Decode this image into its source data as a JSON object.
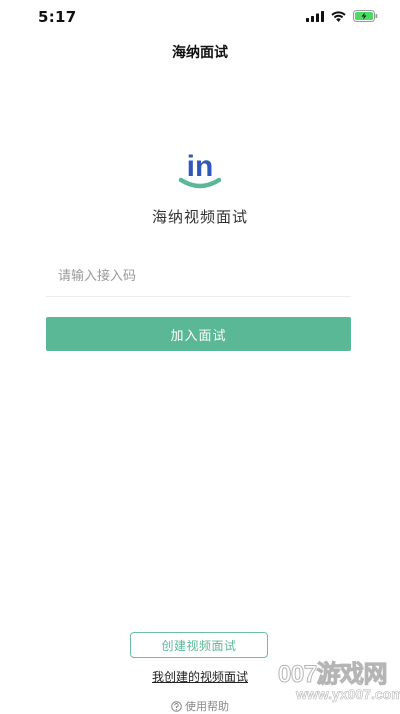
{
  "status_bar": {
    "time": "5:17",
    "icons": [
      "signal-icon",
      "wifi-icon",
      "battery-charging-icon"
    ]
  },
  "header": {
    "title": "海纳面试"
  },
  "app": {
    "logo_text": "in",
    "name": "海纳视频面试"
  },
  "join_form": {
    "code_placeholder": "请输入接入码",
    "code_value": "",
    "join_label": "加入面试"
  },
  "footer": {
    "create_label": "创建视频面试",
    "my_interviews_label": "我创建的视频面试",
    "help_label": "使用帮助",
    "help_icon": "help-icon"
  },
  "watermark": {
    "brand": "007游戏网",
    "url": "www.yx007.com"
  },
  "colors": {
    "accent": "#5bb896",
    "accent_border": "#6cc0a1",
    "logo_blue": "#2f58b8"
  }
}
